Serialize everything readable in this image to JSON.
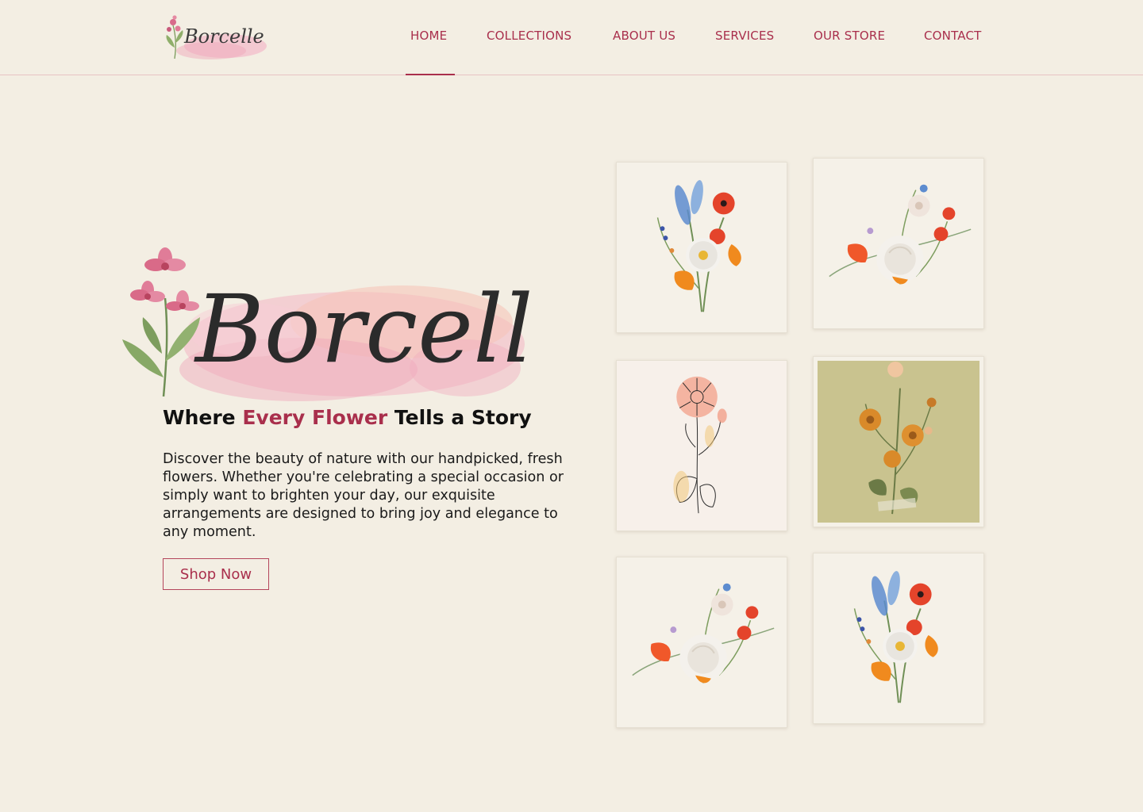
{
  "brand": {
    "name": "Borcelle"
  },
  "nav": {
    "items": [
      {
        "label": "HOME",
        "active": true
      },
      {
        "label": "COLLECTIONS"
      },
      {
        "label": "ABOUT US"
      },
      {
        "label": "SERVICES"
      },
      {
        "label": "OUR STORE"
      },
      {
        "label": "CONTACT"
      }
    ]
  },
  "hero": {
    "tagline_start": "Where ",
    "tagline_accent": "Every Flower",
    "tagline_end": " Tells a Story",
    "description": "Discover the beauty of nature with our handpicked, fresh flowers. Whether you're celebrating a special occasion or simply want to brighten your day, our exquisite arrangements are designed to bring joy and elegance to any moment.",
    "cta_label": "Shop Now"
  },
  "gallery": {
    "items": [
      {
        "icon": "wildflower-bouquet-icon"
      },
      {
        "icon": "peony-bouquet-icon"
      },
      {
        "icon": "line-art-flower-icon"
      },
      {
        "icon": "dried-flowers-icon"
      },
      {
        "icon": "peony-bouquet-icon"
      },
      {
        "icon": "wildflower-bouquet-icon"
      }
    ]
  },
  "colors": {
    "background": "#f3eee3",
    "accent": "#a92f4c",
    "header_border": "#e7c2c4",
    "watercolor": "#f0b8c4"
  }
}
